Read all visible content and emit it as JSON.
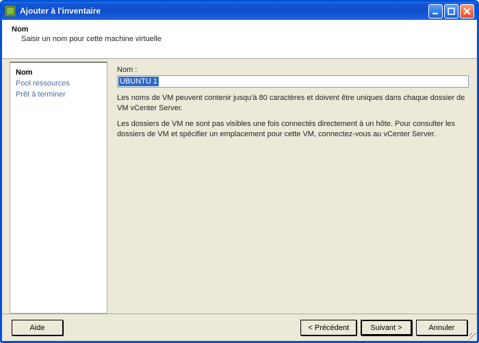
{
  "window": {
    "title": "Ajouter à l'inventaire"
  },
  "header": {
    "title": "Nom",
    "subtitle": "Saisir un nom pour cette machine virtuelle"
  },
  "sidebar": {
    "steps": [
      "Nom",
      "Pool ressources",
      "Prêt à terminer"
    ],
    "activeIndex": 0
  },
  "main": {
    "name_label": "Nom :",
    "name_value": "UBUNTU 1",
    "desc1": "Les noms de VM peuvent contenir jusqu'à 80 caractères et doivent être uniques dans chaque dossier de VM vCenter Server.",
    "desc2": "Les dossiers de VM ne sont pas visibles une fois connectés directement à un hôte. Pour consulter les dossiers de VM et spécifier un emplacement pour cette VM, connectez-vous au vCenter Server."
  },
  "footer": {
    "help": "Aide",
    "prev": "< Précédent",
    "next": "Suivant >",
    "cancel": "Annuler"
  }
}
